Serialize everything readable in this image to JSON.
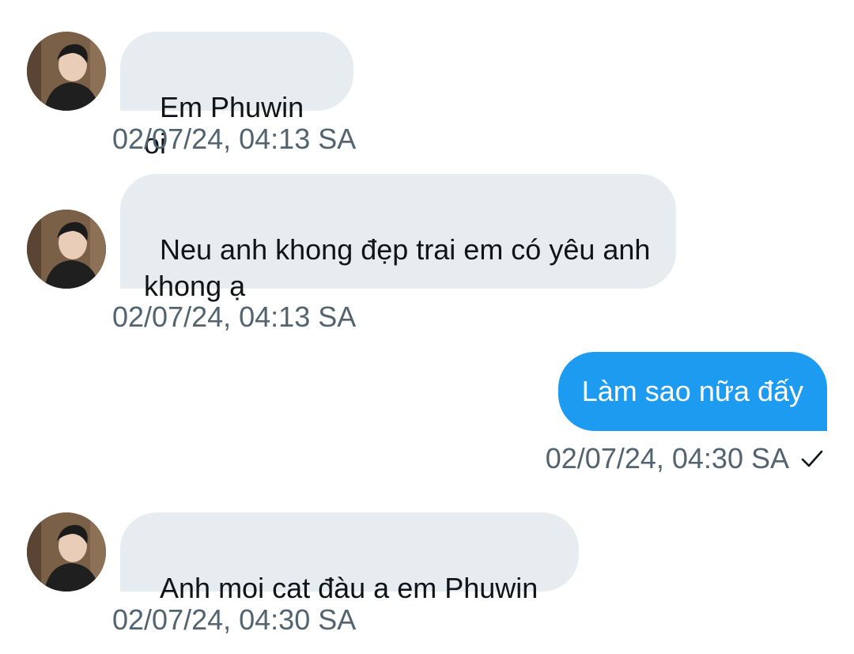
{
  "conversation": {
    "messages": [
      {
        "direction": "incoming",
        "text": "Em Phuwin oi",
        "timestamp": "02/07/24, 04:13 SA",
        "avatar_icon": "user-avatar-photo"
      },
      {
        "direction": "incoming",
        "text": "Neu anh khong đẹp trai em có yêu anh khong ạ",
        "timestamp": "02/07/24, 04:13 SA",
        "avatar_icon": "user-avatar-photo"
      },
      {
        "direction": "outgoing",
        "text": "Làm sao nữa đấy",
        "timestamp": "02/07/24, 04:30 SA",
        "status_icon": "check-icon"
      },
      {
        "direction": "incoming",
        "text": "Anh moi cat đàu a em Phuwin",
        "timestamp": "02/07/24, 04:30 SA",
        "avatar_icon": "user-avatar-photo"
      }
    ]
  },
  "colors": {
    "incoming_bubble": "#e7ecf0",
    "outgoing_bubble": "#1d9bf0",
    "timestamp_text": "#536471",
    "message_text": "#0f1419"
  }
}
